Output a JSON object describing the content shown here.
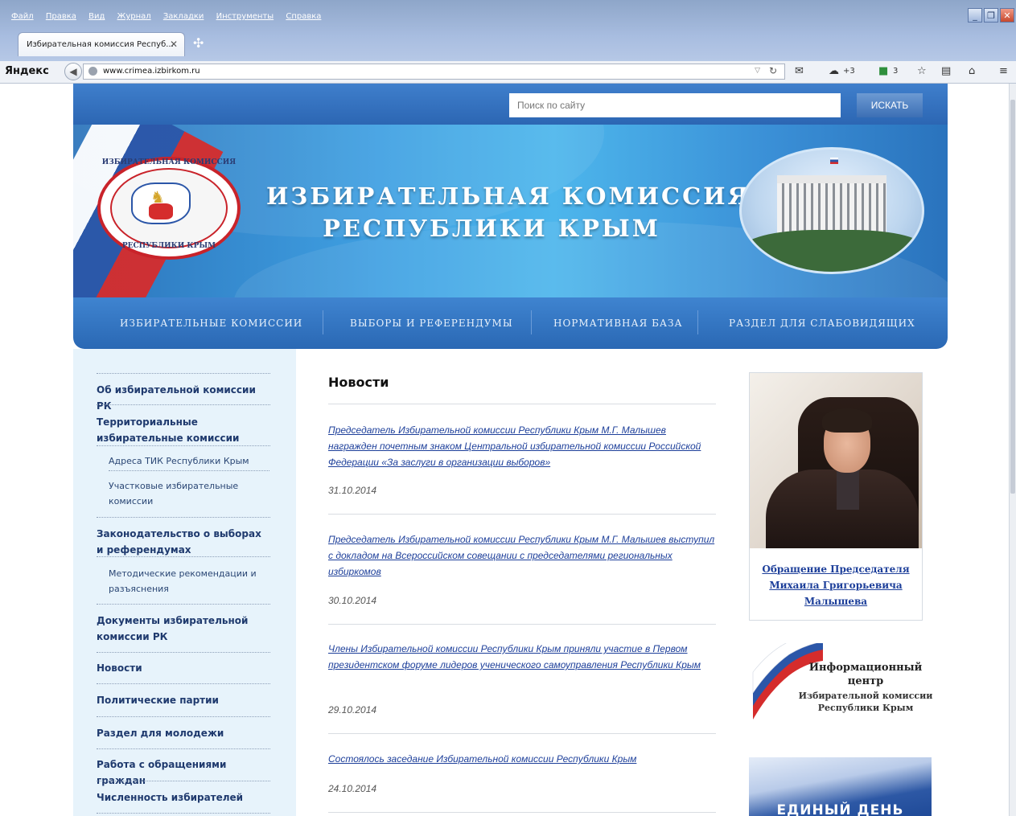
{
  "browser": {
    "menu": [
      "Файл",
      "Правка",
      "Вид",
      "Журнал",
      "Закладки",
      "Инструменты",
      "Справка"
    ],
    "tab_title": "Избирательная комиссия Респуб...",
    "tab_close": "✕",
    "new_tab": "✣",
    "yandex": "Яндекс",
    "url": "www.crimea.izbirkom.ru",
    "toolbar": {
      "cloud_count": "+3",
      "badge_count": "3"
    }
  },
  "site": {
    "search_placeholder": "Поиск по сайту",
    "search_button": "ИСКАТЬ",
    "emblem_top": "ИЗБИРАТЕЛЬНАЯ КОМИССИЯ",
    "emblem_bottom": "РЕСПУБЛИКИ КРЫМ",
    "title_line1": "ИЗБИРАТЕЛЬНАЯ КОМИССИЯ",
    "title_line2": "РЕСПУБЛИКИ КРЫМ",
    "nav": [
      "ИЗБИРАТЕЛЬНЫЕ КОМИССИИ",
      "ВЫБОРЫ И РЕФЕРЕНДУМЫ",
      "НОРМАТИВНАЯ БАЗА",
      "РАЗДЕЛ ДЛЯ СЛАБОВИДЯЩИХ"
    ]
  },
  "sidebar": {
    "items": [
      "Об избирательной комиссии РК",
      "Территориальные избирательные комиссии",
      "Адреса ТИК Республики Крым",
      "Участковые избирательные комиссии",
      "Законодательство о выборах и референдумах",
      "Методические рекомендации и разъяснения",
      "Документы избирательной комиссии РК",
      "Новости",
      "Политические партии",
      "Раздел для молодежи",
      "Работа с обращениями граждан",
      "Численность избирателей"
    ]
  },
  "news": {
    "heading": "Новости",
    "items": [
      {
        "title": "Председатель Избирательной комиссии Республики Крым М.Г. Малышев награжден почетным знаком Центральной избирательной комиссии Российской Федерации «За заслуги в организации выборов»",
        "date": "31.10.2014"
      },
      {
        "title": "Председатель Избирательной комиссии Республики Крым М.Г. Малышев выступил с докладом на Всероссийском совещании с председателями региональных избиркомов",
        "date": "30.10.2014"
      },
      {
        "title": "Члены Избирательной комиссии Республики Крым приняли участие в Первом президентском форуме лидеров ученического самоуправления Республики Крым",
        "date": "29.10.2014"
      },
      {
        "title": "Состоялось заседание Избирательной комиссии Республики Крым",
        "date": "24.10.2014"
      }
    ]
  },
  "right": {
    "chairman_caption": "Обращение Председателя Михаила Григорьевича Малышева",
    "info_title": "Информационный центр",
    "info_sub": "Избирательной комиссии Республики Крым",
    "eday": "ЕДИНЫЙ ДЕНЬ"
  }
}
